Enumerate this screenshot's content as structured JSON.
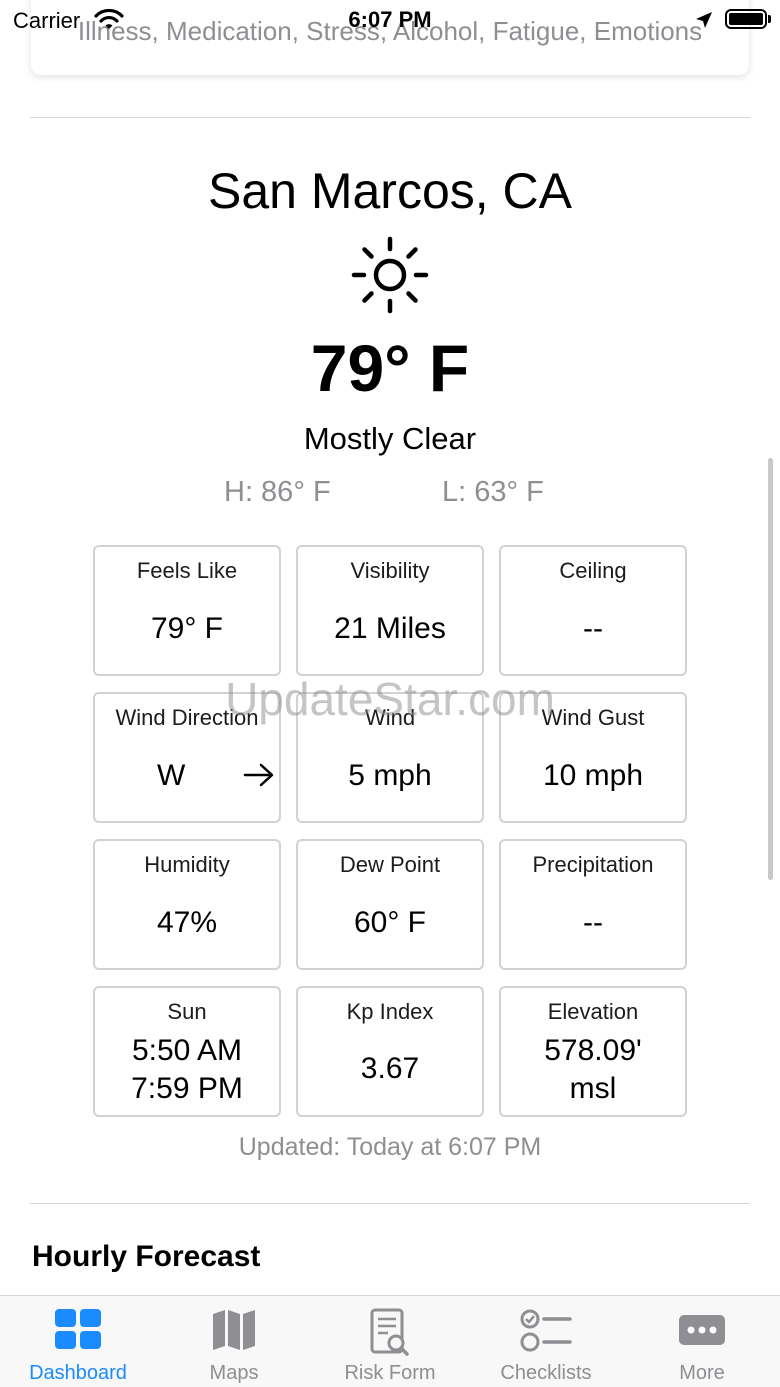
{
  "status_bar": {
    "carrier": "Carrier",
    "time": "6:07 PM"
  },
  "risk_card": {
    "factors_text": "Illness, Medication, Stress, Alcohol, Fatigue, Emotions"
  },
  "weather": {
    "location": "San Marcos, CA",
    "icon": "sun-icon",
    "temperature": "79° F",
    "condition": "Mostly Clear",
    "high": "H: 86° F",
    "low": "L: 63° F",
    "tiles": {
      "feels_like": {
        "label": "Feels Like",
        "value": "79° F"
      },
      "visibility": {
        "label": "Visibility",
        "value": "21 Miles"
      },
      "ceiling": {
        "label": "Ceiling",
        "value": "--"
      },
      "wind_direction": {
        "label": "Wind Direction",
        "value": "W",
        "icon": "arrow-right-icon"
      },
      "wind": {
        "label": "Wind",
        "value": "5 mph"
      },
      "wind_gust": {
        "label": "Wind Gust",
        "value": "10 mph"
      },
      "humidity": {
        "label": "Humidity",
        "value": "47%"
      },
      "dew_point": {
        "label": "Dew Point",
        "value": "60° F"
      },
      "precipitation": {
        "label": "Precipitation",
        "value": "--"
      },
      "sun": {
        "label": "Sun",
        "sunrise": "5:50 AM",
        "sunset": "7:59 PM"
      },
      "kp_index": {
        "label": "Kp Index",
        "value": "3.67"
      },
      "elevation": {
        "label": "Elevation",
        "value_line1": "578.09'",
        "value_line2": "msl"
      }
    },
    "updated": "Updated: Today at 6:07 PM"
  },
  "hourly_forecast": {
    "title": "Hourly Forecast"
  },
  "watermark": "UpdateStar.com",
  "tab_bar": {
    "active": "Dashboard",
    "active_color": "#1a8cff",
    "inactive_color": "#8e8e93",
    "tabs": [
      {
        "label": "Dashboard",
        "icon": "dashboard-grid-icon"
      },
      {
        "label": "Maps",
        "icon": "map-icon"
      },
      {
        "label": "Risk Form",
        "icon": "risk-form-icon"
      },
      {
        "label": "Checklists",
        "icon": "checklist-icon"
      },
      {
        "label": "More",
        "icon": "more-icon"
      }
    ]
  }
}
